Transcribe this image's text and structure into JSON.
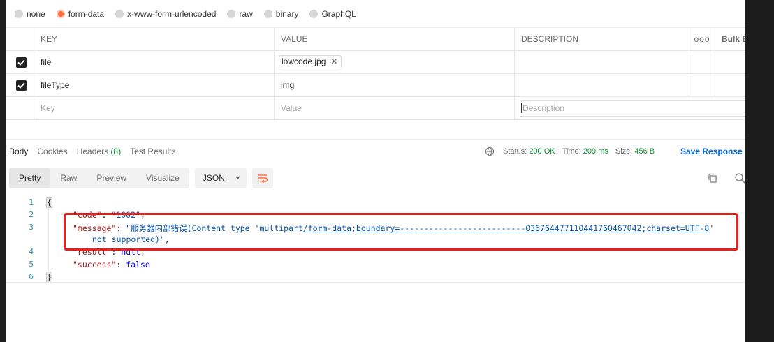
{
  "body_types": [
    {
      "label": "none",
      "selected": false
    },
    {
      "label": "form-data",
      "selected": true
    },
    {
      "label": "x-www-form-urlencoded",
      "selected": false
    },
    {
      "label": "raw",
      "selected": false
    },
    {
      "label": "binary",
      "selected": false
    },
    {
      "label": "GraphQL",
      "selected": false
    }
  ],
  "params_table": {
    "headers": {
      "key": "KEY",
      "value": "VALUE",
      "description": "DESCRIPTION",
      "more": "ooo",
      "bulk_edit": "Bulk E"
    },
    "rows": [
      {
        "checked": true,
        "key": "file",
        "value": "lowcode.jpg",
        "value_is_file": true,
        "description": ""
      },
      {
        "checked": true,
        "key": "fileType",
        "value": "img",
        "description": ""
      }
    ],
    "placeholders": {
      "key": "Key",
      "value": "Value",
      "description": "Description"
    }
  },
  "response": {
    "tabs": [
      {
        "label": "Body",
        "active": true
      },
      {
        "label": "Cookies"
      },
      {
        "label": "Headers",
        "count": "(8)"
      },
      {
        "label": "Test Results"
      }
    ],
    "status_label": "Status:",
    "status_value": "200 OK",
    "time_label": "Time:",
    "time_value": "209 ms",
    "size_label": "Size:",
    "size_value": "456 B",
    "save_label": "Save Response",
    "view_modes": [
      "Pretty",
      "Raw",
      "Preview",
      "Visualize"
    ],
    "active_view": "Pretty",
    "format": "JSON"
  },
  "code": {
    "line_numbers": [
      "1",
      "2",
      "3",
      "",
      "4",
      "5",
      "6"
    ],
    "open_brace": "{",
    "close_brace": "}",
    "code_key": "\"code\"",
    "code_value": "\"1002\"",
    "message_key": "\"message\"",
    "message_value_a": "\"服务器内部错误(Content type 'multipart",
    "message_value_b": "/form-data;boundary=--------------------------036764477110441760467042;charset=UTF-8",
    "message_value_c": "'",
    "message_value_cont": "not supported)\"",
    "result_key": "\"result\"",
    "result_value": "null",
    "success_key": "\"success\"",
    "success_value": "false"
  },
  "colors": {
    "accent": "#ff6c37",
    "status_green": "#0a8a2e",
    "link_blue": "#0265d2",
    "annotation_red": "#e8211f"
  }
}
